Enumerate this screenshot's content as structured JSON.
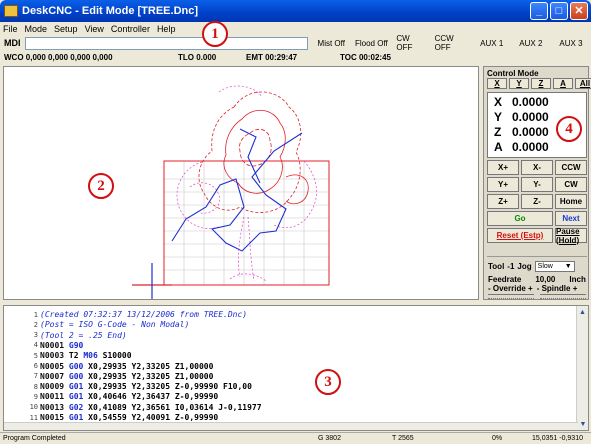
{
  "window": {
    "title": "DeskCNC - Edit Mode [TREE.Dnc]"
  },
  "menu": [
    "File",
    "Mode",
    "Setup",
    "View",
    "Controller",
    "Help"
  ],
  "toolbar": {
    "mdi_label": "MDI",
    "mdi_value": "",
    "buttons": [
      "Mist Off",
      "Flood Off",
      "CW OFF",
      "CCW OFF",
      "AUX 1",
      "AUX 2",
      "AUX 3"
    ]
  },
  "status": {
    "wco": "WCO 0,000 0,000 0,000 0,000",
    "tlo": "TLO 0.000",
    "emt": "EMT 00:29:47",
    "toc": "TOC 00:02:45"
  },
  "control": {
    "title": "Control Mode",
    "axis_buttons": [
      "X",
      "Y",
      "Z",
      "A",
      "All"
    ],
    "coords": [
      {
        "axis": "X",
        "value": "0.0000"
      },
      {
        "axis": "Y",
        "value": "0.0000"
      },
      {
        "axis": "Z",
        "value": "0.0000"
      },
      {
        "axis": "A",
        "value": "0.0000"
      }
    ],
    "jog": [
      "X+",
      "X-",
      "CCW",
      "Y+",
      "Y-",
      "CW",
      "Z+",
      "Z-",
      "Home"
    ],
    "go": "Go",
    "next": "Next",
    "reset": "Reset (Estp)",
    "pause": "Pause (Hold)",
    "tool_label": "Tool",
    "tool_value": "-1",
    "jog_label": "Jog",
    "jog_value": "Slow",
    "feed_label": "Feedrate",
    "feed_value": "10,00",
    "feed_unit": "Inch",
    "override_label": "- Override +",
    "spindle_label": "- Spindle +"
  },
  "code": [
    {
      "n": "1",
      "parts": [
        {
          "t": "(Created 07:32:37 13/12/2006 from TREE.Dnc)",
          "c": "cmt"
        }
      ]
    },
    {
      "n": "2",
      "parts": [
        {
          "t": "(Post = ISO G-Code - Non Modal)",
          "c": "cmt"
        }
      ]
    },
    {
      "n": "3",
      "parts": [
        {
          "t": "(Tool 2 = .25 End)",
          "c": "cmt"
        }
      ]
    },
    {
      "n": "4",
      "parts": [
        {
          "t": "N0001 ",
          "c": "nb"
        },
        {
          "t": "G90",
          "c": "g"
        }
      ]
    },
    {
      "n": "5",
      "parts": [
        {
          "t": "N0003 ",
          "c": "nb"
        },
        {
          "t": "T2 ",
          "c": "a"
        },
        {
          "t": "M06 ",
          "c": "g"
        },
        {
          "t": "S10000",
          "c": "a"
        }
      ]
    },
    {
      "n": "6",
      "parts": [
        {
          "t": "N0005 ",
          "c": "nb"
        },
        {
          "t": "G00 ",
          "c": "g"
        },
        {
          "t": "X0,29935 Y2,33205 Z1,00000",
          "c": "a"
        }
      ]
    },
    {
      "n": "7",
      "parts": [
        {
          "t": "N0007 ",
          "c": "nb"
        },
        {
          "t": "G00 ",
          "c": "g"
        },
        {
          "t": "X0,29935 Y2,33205 Z1,00000",
          "c": "a"
        }
      ]
    },
    {
      "n": "8",
      "parts": [
        {
          "t": "N0009 ",
          "c": "nb"
        },
        {
          "t": "G01 ",
          "c": "g"
        },
        {
          "t": "X0,29935 Y2,33205 Z-0,99990 F10,00",
          "c": "a"
        }
      ]
    },
    {
      "n": "9",
      "parts": [
        {
          "t": "N0011 ",
          "c": "nb"
        },
        {
          "t": "G01 ",
          "c": "g"
        },
        {
          "t": "X0,40646 Y2,36437 Z-0,99990",
          "c": "a"
        }
      ]
    },
    {
      "n": "10",
      "parts": [
        {
          "t": "N0013 ",
          "c": "nb"
        },
        {
          "t": "G02 ",
          "c": "g"
        },
        {
          "t": "X0,41089 Y2,36561 I0,03614 J-0,11977",
          "c": "a"
        }
      ]
    },
    {
      "n": "11",
      "parts": [
        {
          "t": "N0015 ",
          "c": "nb"
        },
        {
          "t": "G01 ",
          "c": "g"
        },
        {
          "t": "X0,54559 Y2,40091 Z-0,99990",
          "c": "a"
        }
      ]
    }
  ],
  "statusbar": {
    "left": "Program Completed",
    "g": "G 3802",
    "t": "T 2565",
    "pct": "0%",
    "pos": "15,0351 -0,9310"
  },
  "annotations": [
    "1",
    "2",
    "3",
    "4"
  ],
  "colors": {
    "toolpath_red": "#e0202a",
    "toolpath_pink": "#e040c8",
    "toolpath_blue": "#2030d0",
    "grid": "#c8c8c8",
    "annotation": "#d01010"
  }
}
